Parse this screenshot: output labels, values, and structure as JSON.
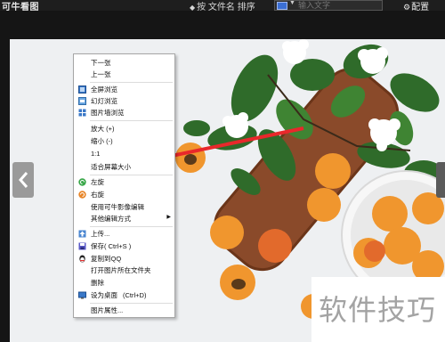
{
  "app": {
    "title": "可牛看图"
  },
  "toolbar": {
    "sort_label": "按 文件名 排序",
    "search_placeholder": "输入文字",
    "settings_label": "配置"
  },
  "context_menu": {
    "items": [
      {
        "label": "下一张",
        "icon": ""
      },
      {
        "label": "上一张",
        "icon": ""
      },
      {
        "label": "全屏浏览",
        "icon": "fullscreen-icon"
      },
      {
        "label": "幻灯浏览",
        "icon": "slideshow-icon"
      },
      {
        "label": "图片墙浏览",
        "icon": "photo-wall-icon"
      },
      {
        "label": "放大 (+)",
        "icon": ""
      },
      {
        "label": "缩小 (-)",
        "icon": ""
      },
      {
        "label": "1:1",
        "icon": ""
      },
      {
        "label": "适合屏幕大小",
        "icon": ""
      },
      {
        "label": "左旋",
        "icon": "rotate-left-icon"
      },
      {
        "label": "右旋",
        "icon": "rotate-right-icon"
      },
      {
        "label": "使用可牛影像编辑",
        "icon": ""
      },
      {
        "label": "其他编辑方式",
        "icon": ""
      },
      {
        "label": "上传...",
        "icon": "upload-icon"
      },
      {
        "label": "保存( Ctrl+S )",
        "icon": "save-icon"
      },
      {
        "label": "复制到QQ",
        "icon": "qq-icon"
      },
      {
        "label": "打开图片所在文件夹",
        "icon": ""
      },
      {
        "label": "删除",
        "icon": ""
      },
      {
        "label": "设为桌面",
        "shortcut": "(Ctrl+D)",
        "icon": "desktop-icon"
      },
      {
        "label": "图片属性...",
        "icon": ""
      }
    ]
  },
  "watermark": {
    "text": "软件技巧"
  },
  "colors": {
    "accent": "#e8282b",
    "menu_border": "#a6a6a6",
    "apricot": "#f0962e"
  }
}
